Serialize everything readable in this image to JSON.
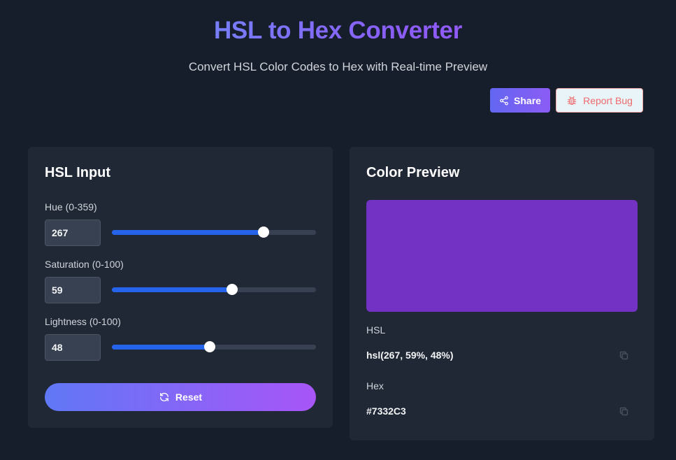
{
  "header": {
    "title": "HSL to Hex Converter",
    "subtitle": "Convert HSL Color Codes to Hex with Real-time Preview",
    "share_label": "Share",
    "report_bug_label": "Report Bug"
  },
  "input_panel": {
    "title": "HSL Input",
    "hue": {
      "label": "Hue (0-359)",
      "value": "267",
      "min": 0,
      "max": 359
    },
    "saturation": {
      "label": "Saturation (0-100)",
      "value": "59",
      "min": 0,
      "max": 100
    },
    "lightness": {
      "label": "Lightness (0-100)",
      "value": "48",
      "min": 0,
      "max": 100
    },
    "reset_label": "Reset"
  },
  "preview_panel": {
    "title": "Color Preview",
    "swatch_color": "#7332C3",
    "hsl_label": "HSL",
    "hsl_value": "hsl(267, 59%, 48%)",
    "hex_label": "Hex",
    "hex_value": "#7332C3"
  },
  "icons": {
    "share": "share-icon",
    "bug": "bug-icon",
    "reset": "refresh-icon",
    "copy": "copy-icon"
  }
}
